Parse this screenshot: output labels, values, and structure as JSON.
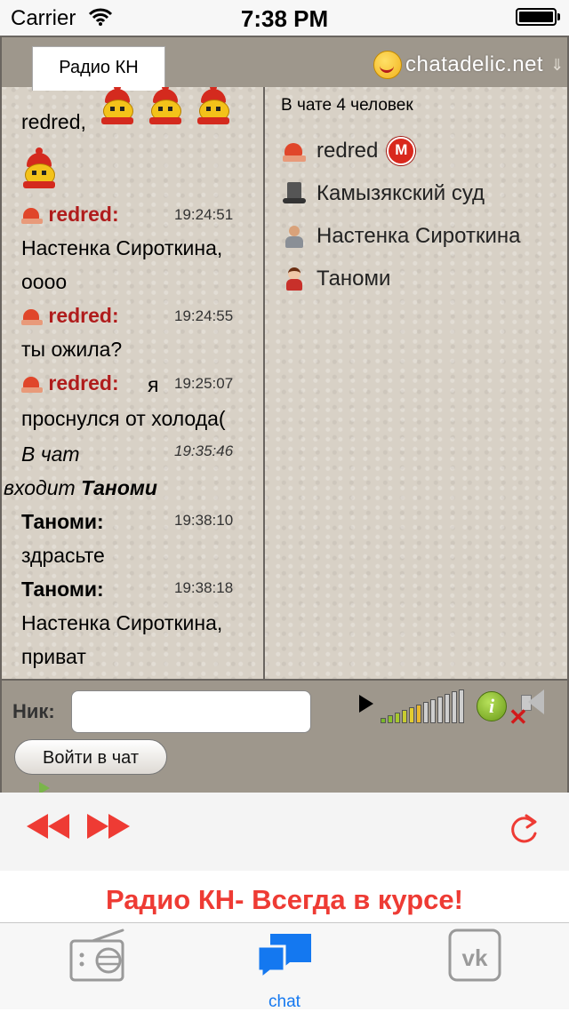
{
  "status_bar": {
    "carrier": "Carrier",
    "time": "7:38 PM"
  },
  "web_chat": {
    "room_tab": "Радио КН",
    "brand": "chatadelic.net",
    "messages": {
      "line1_text": "redred,",
      "msg1_nick": "redred:",
      "msg1_time": "19:24:51",
      "msg1_line1": "Настенка Сироткина,",
      "msg1_line2": "оооо",
      "msg2_nick": "redred:",
      "msg2_time": "19:24:55",
      "msg2_line1": "ты ожила?",
      "msg3_nick": "redred:",
      "msg3_word": "я",
      "msg3_time": "19:25:07",
      "msg3_line1": "проснулся от холода(",
      "sys_text1": "В чат",
      "sys_time": "19:35:46",
      "sys_text2": "входит",
      "sys_name": "Таноми",
      "msg4_nick": "Таноми:",
      "msg4_time": "19:38:10",
      "msg4_line1": "здрасьте",
      "msg5_nick": "Таноми:",
      "msg5_time": "19:38:18",
      "msg5_line1": "Настенка Сироткина,",
      "msg5_line2": "приват"
    },
    "users": {
      "count_label": "В чате 4 человек",
      "list": [
        {
          "name": "redred",
          "icon": "santa-hat-icon",
          "badge": "M"
        },
        {
          "name": "Камызякский суд",
          "icon": "top-hat-icon"
        },
        {
          "name": "Настенка Сироткина",
          "icon": "person-icon"
        },
        {
          "name": "Таноми",
          "icon": "woman-icon"
        }
      ]
    },
    "login": {
      "nick_label": "Ник:",
      "nick_value": "",
      "join_button": "Войти в чат"
    }
  },
  "player": {
    "banner": "Радио КН- Всегда в курсе!"
  },
  "tab_bar": {
    "tabs": [
      {
        "icon": "radio-icon",
        "label": ""
      },
      {
        "icon": "chat-bubbles-icon",
        "label": "chat",
        "active": true
      },
      {
        "icon": "vk-icon",
        "label": ""
      }
    ]
  },
  "colors": {
    "accent_red": "#ee3b34",
    "active_tab_blue": "#1478f0",
    "nick_red": "#b01c1c"
  }
}
